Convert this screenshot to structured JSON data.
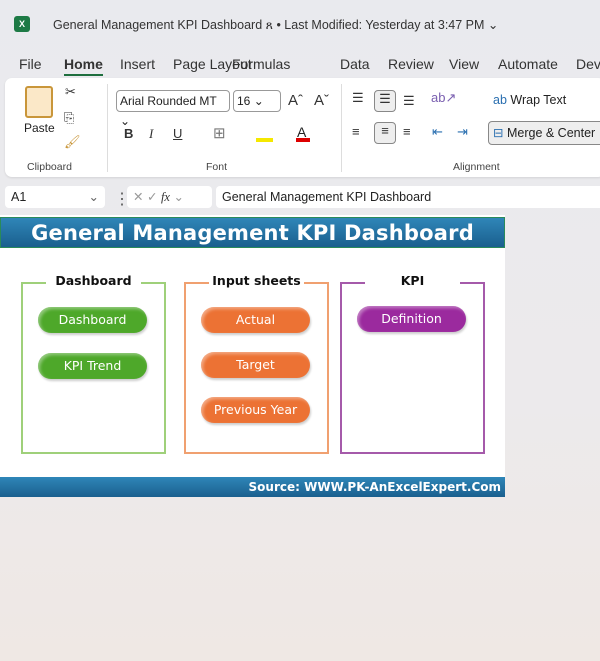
{
  "window": {
    "app_icon": "excel-icon",
    "title": "General Management KPI Dashboard",
    "modified": "• Last Modified: Yesterday at 3:47 PM"
  },
  "menu": [
    "File",
    "Home",
    "Insert",
    "Page Layout",
    "Formulas",
    "Data",
    "Review",
    "View",
    "Automate",
    "Dev"
  ],
  "ribbon": {
    "clipboard": {
      "paste": "Paste",
      "label": "Clipboard"
    },
    "font": {
      "name": "Arial Rounded MT",
      "size": "16",
      "label": "Font",
      "bold": "B",
      "italic": "I",
      "underline": "U"
    },
    "alignment": {
      "wrap": "Wrap Text",
      "merge": "Merge & Center",
      "label": "Alignment"
    }
  },
  "formula_bar": {
    "cell": "A1",
    "fx": "fx",
    "value": "General Management KPI Dashboard"
  },
  "sheet": {
    "header": "General Management KPI Dashboard",
    "footer": "Source: WWW.PK-AnExcelExpert.Com",
    "groups": [
      {
        "title": "Dashboard",
        "color": "#9fd07a",
        "buttons": [
          "Dashboard",
          "KPI Trend"
        ]
      },
      {
        "title": "Input sheets",
        "color": "#f0a070",
        "buttons": [
          "Actual",
          "Target",
          "Previous Year"
        ]
      },
      {
        "title": "KPI",
        "color": "#a55aaa",
        "buttons": [
          "Definition"
        ]
      }
    ]
  }
}
